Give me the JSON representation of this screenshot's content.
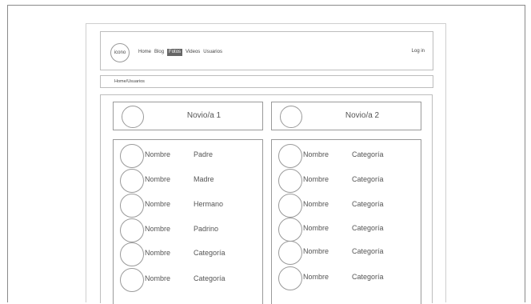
{
  "nav": {
    "logo": "icono",
    "items": [
      {
        "label": "Home",
        "active": false
      },
      {
        "label": "Blog",
        "active": false
      },
      {
        "label": "Fotos",
        "active": true
      },
      {
        "label": "Videos",
        "active": false
      },
      {
        "label": "Usuarios",
        "active": false
      }
    ],
    "login": "Log in"
  },
  "breadcrumb": "Home/Usuarios",
  "partner1": {
    "label": "Novio/a 1"
  },
  "partner2": {
    "label": "Novio/a 2"
  },
  "col1": [
    {
      "name": "Nombre",
      "role": "Padre"
    },
    {
      "name": "Nombre",
      "role": "Madre"
    },
    {
      "name": "Nombre",
      "role": "Hermano"
    },
    {
      "name": "Nombre",
      "role": "Padrino"
    },
    {
      "name": "Nombre",
      "role": "Categoría"
    },
    {
      "name": "Nombre",
      "role": "Categoría"
    }
  ],
  "col2": [
    {
      "name": "Nombre",
      "role": "Categoría"
    },
    {
      "name": "Nombre",
      "role": "Categoría"
    },
    {
      "name": "Nombre",
      "role": "Categoría"
    },
    {
      "name": "Nombre",
      "role": "Categoría"
    },
    {
      "name": "Nombre",
      "role": "Categoría"
    },
    {
      "name": "Nombre",
      "role": "Categoría"
    }
  ]
}
